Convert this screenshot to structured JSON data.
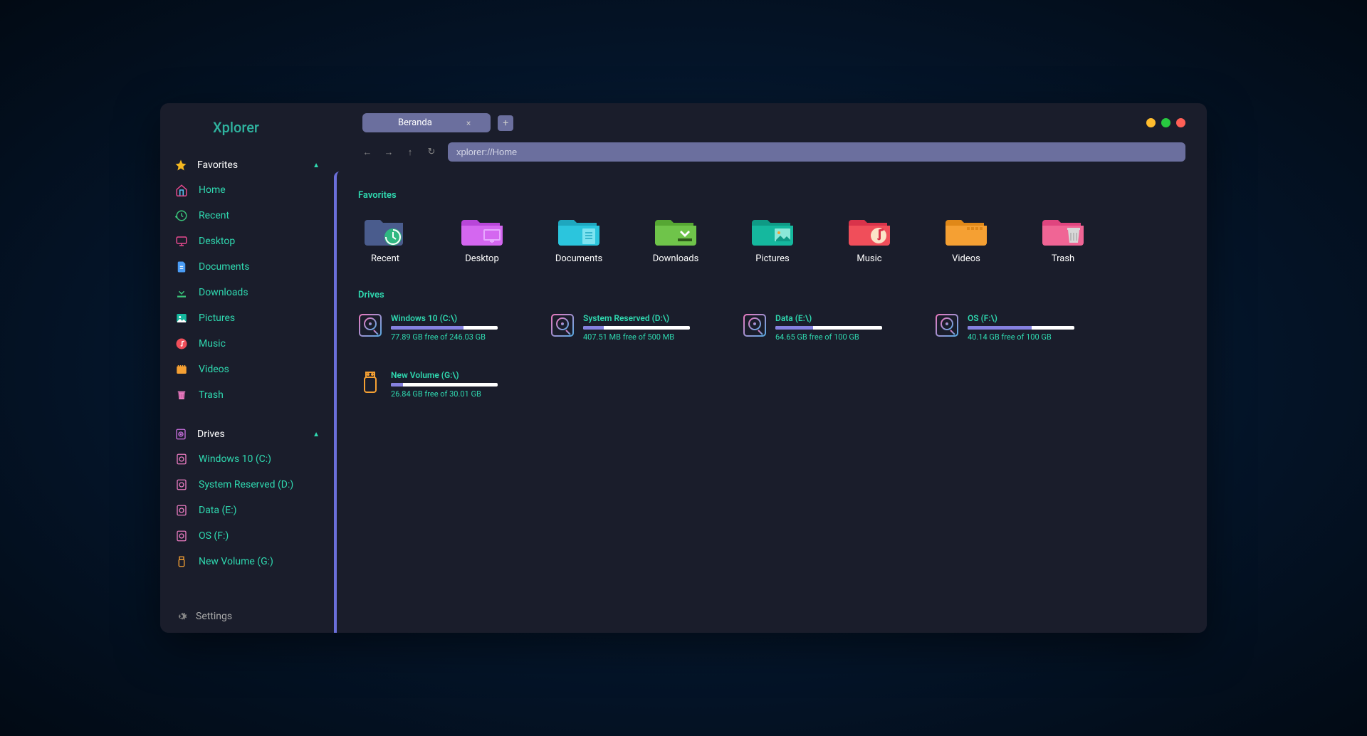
{
  "app": {
    "title": "Xplorer"
  },
  "tabs": [
    {
      "label": "Beranda"
    }
  ],
  "path": "xplorer://Home",
  "sidebar": {
    "favorites_label": "Favorites",
    "drives_label": "Drives",
    "settings_label": "Settings",
    "fav_items": [
      {
        "label": "Home"
      },
      {
        "label": "Recent"
      },
      {
        "label": "Desktop"
      },
      {
        "label": "Documents"
      },
      {
        "label": "Downloads"
      },
      {
        "label": "Pictures"
      },
      {
        "label": "Music"
      },
      {
        "label": "Videos"
      },
      {
        "label": "Trash"
      }
    ],
    "drive_items": [
      {
        "label": "Windows 10 (C:)"
      },
      {
        "label": "System Reserved (D:)"
      },
      {
        "label": "Data (E:)"
      },
      {
        "label": "OS (F:)"
      },
      {
        "label": "New Volume (G:)"
      }
    ]
  },
  "main": {
    "favorites_label": "Favorites",
    "drives_label": "Drives",
    "fav_items": [
      {
        "label": "Recent"
      },
      {
        "label": "Desktop"
      },
      {
        "label": "Documents"
      },
      {
        "label": "Downloads"
      },
      {
        "label": "Pictures"
      },
      {
        "label": "Music"
      },
      {
        "label": "Videos"
      },
      {
        "label": "Trash"
      }
    ],
    "drives": [
      {
        "name": "Windows 10 (C:\\)",
        "free": "77.89 GB free of 246.03 GB",
        "used_pct": 68
      },
      {
        "name": "System Reserved (D:\\)",
        "free": "407.51 MB free of 500 MB",
        "used_pct": 19
      },
      {
        "name": "Data (E:\\)",
        "free": "64.65 GB free of 100 GB",
        "used_pct": 35
      },
      {
        "name": "OS (F:\\)",
        "free": "40.14 GB free of 100 GB",
        "used_pct": 60
      },
      {
        "name": "New Volume (G:\\)",
        "free": "26.84 GB free of 30.01 GB",
        "used_pct": 11,
        "usb": true
      }
    ]
  },
  "colors": {
    "accent": "#2fd9b0",
    "purple": "#6b6fda"
  }
}
